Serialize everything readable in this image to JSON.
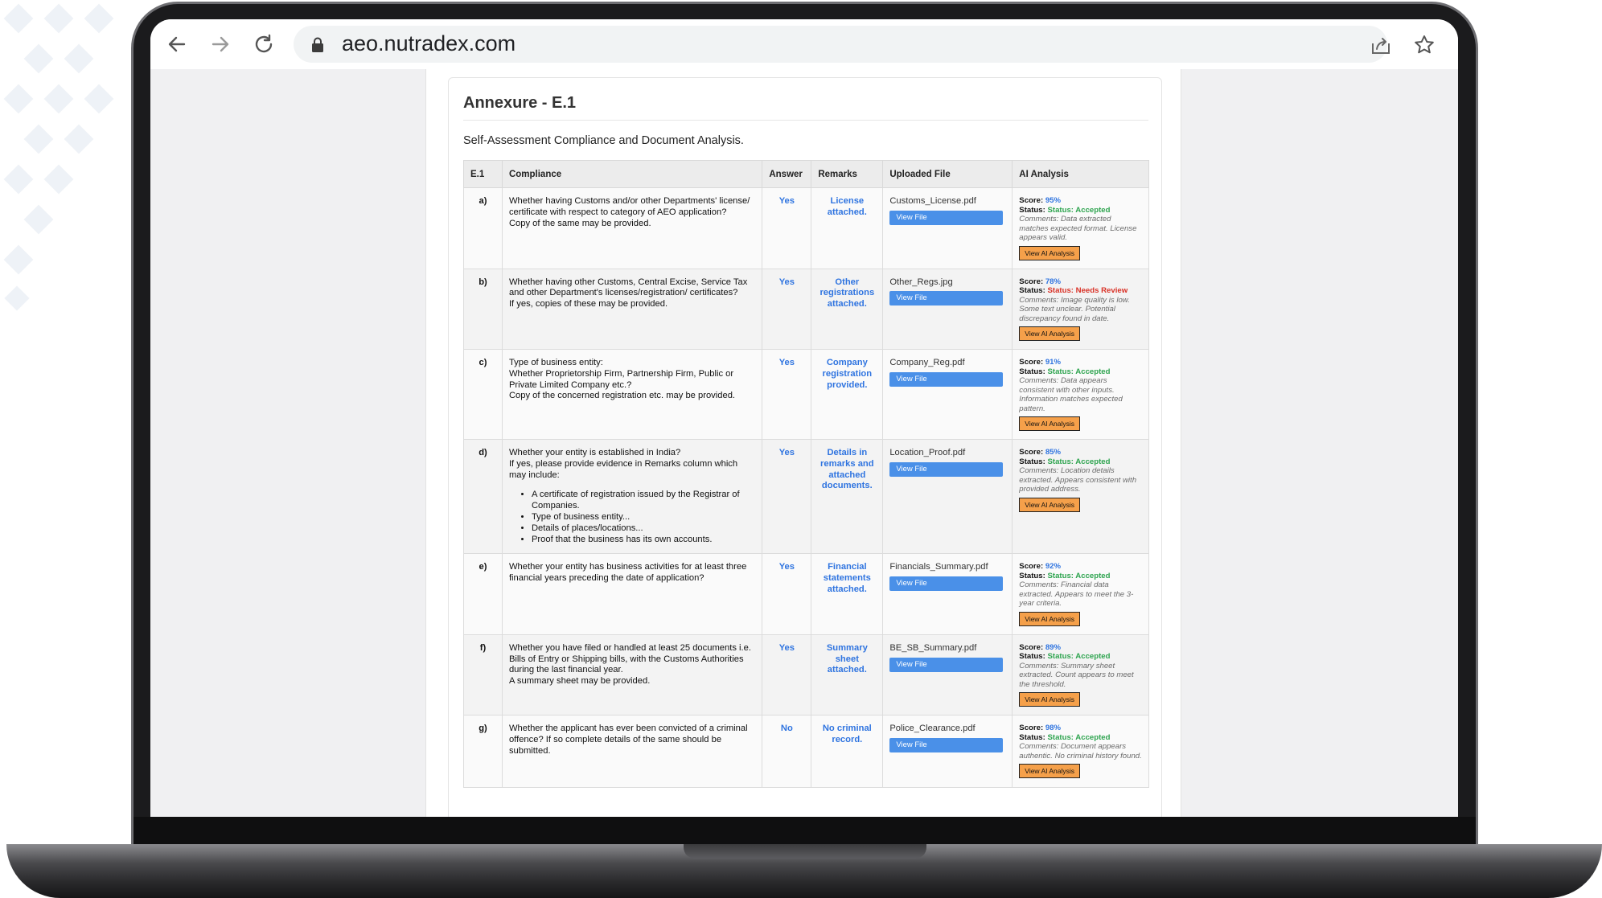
{
  "browser": {
    "url": "aeo.nutradex.com",
    "icons": [
      "back-icon",
      "forward-icon",
      "reload-icon",
      "lock-icon",
      "share-icon",
      "star-icon"
    ]
  },
  "colors": {
    "link_blue": "#2f74e0",
    "button_blue": "#4a90e8",
    "accepted_green": "#2ea44f",
    "review_red": "#d93025",
    "ai_button_orange": "#f5a04a"
  },
  "page": {
    "title": "Annexure - E.1",
    "subtitle": "Self-Assessment Compliance and Document Analysis."
  },
  "table": {
    "headers": [
      "E.1",
      "Compliance",
      "Answer",
      "Remarks",
      "Uploaded File",
      "AI Analysis"
    ],
    "view_file_label": "View File",
    "view_ai_label": "View AI Analysis",
    "score_label": "Score:",
    "status_label": "Status:",
    "rows": [
      {
        "key": "a)",
        "compliance": [
          "Whether having Customs and/or other Departments' license/ certificate with respect to category of AEO application?",
          "Copy of the same may be provided."
        ],
        "bullets": [],
        "answer": "Yes",
        "remarks": "License attached.",
        "file": "Customs_License.pdf",
        "score": "95%",
        "status": "Status: Accepted",
        "status_type": "ok",
        "comments": "Comments: Data extracted matches expected format. License appears valid."
      },
      {
        "key": "b)",
        "compliance": [
          "Whether having other Customs, Central Excise, Service Tax and other Department's licenses/registration/ certificates?",
          "If yes, copies of these may be provided."
        ],
        "bullets": [],
        "answer": "Yes",
        "remarks": "Other registrations attached.",
        "file": "Other_Regs.jpg",
        "score": "78%",
        "status": "Status: Needs Review",
        "status_type": "review",
        "comments": "Comments: Image quality is low. Some text unclear. Potential discrepancy found in date."
      },
      {
        "key": "c)",
        "compliance": [
          "Type of business entity:",
          "Whether Proprietorship Firm, Partnership Firm, Public or Private Limited Company etc.?",
          "Copy of the concerned registration etc. may be provided."
        ],
        "bullets": [],
        "answer": "Yes",
        "remarks": "Company registration provided.",
        "file": "Company_Reg.pdf",
        "score": "91%",
        "status": "Status: Accepted",
        "status_type": "ok",
        "comments": "Comments: Data appears consistent with other inputs. Information matches expected pattern."
      },
      {
        "key": "d)",
        "compliance": [
          "Whether your entity is established in India?",
          "If yes, please provide evidence in Remarks column which may include:"
        ],
        "bullets": [
          "A certificate of registration issued by the Registrar of Companies.",
          "Type of business entity...",
          "Details of places/locations...",
          "Proof that the business has its own accounts."
        ],
        "answer": "Yes",
        "remarks": "Details in remarks and attached documents.",
        "file": "Location_Proof.pdf",
        "score": "85%",
        "status": "Status: Accepted",
        "status_type": "ok",
        "comments": "Comments: Location details extracted. Appears consistent with provided address."
      },
      {
        "key": "e)",
        "compliance": [
          "Whether your entity has business activities for at least three financial years preceding the date of application?"
        ],
        "bullets": [],
        "answer": "Yes",
        "remarks": "Financial statements attached.",
        "file": "Financials_Summary.pdf",
        "score": "92%",
        "status": "Status: Accepted",
        "status_type": "ok",
        "comments": "Comments: Financial data extracted. Appears to meet the 3-year criteria."
      },
      {
        "key": "f)",
        "compliance": [
          "Whether you have filed or handled at least 25 documents i.e. Bills of Entry or Shipping bills, with the Customs Authorities during the last financial year.",
          "A summary sheet may be provided."
        ],
        "bullets": [],
        "answer": "Yes",
        "remarks": "Summary sheet attached.",
        "file": "BE_SB_Summary.pdf",
        "score": "89%",
        "status": "Status: Accepted",
        "status_type": "ok",
        "comments": "Comments: Summary sheet extracted. Count appears to meet the threshold."
      },
      {
        "key": "g)",
        "compliance": [
          "Whether the applicant has ever been convicted of a criminal offence? If so complete details of the same should be submitted."
        ],
        "bullets": [],
        "answer": "No",
        "remarks": "No criminal record.",
        "file": "Police_Clearance.pdf",
        "score": "98%",
        "status": "Status: Accepted",
        "status_type": "ok",
        "comments": "Comments: Document appears authentic. No criminal history found."
      }
    ]
  }
}
